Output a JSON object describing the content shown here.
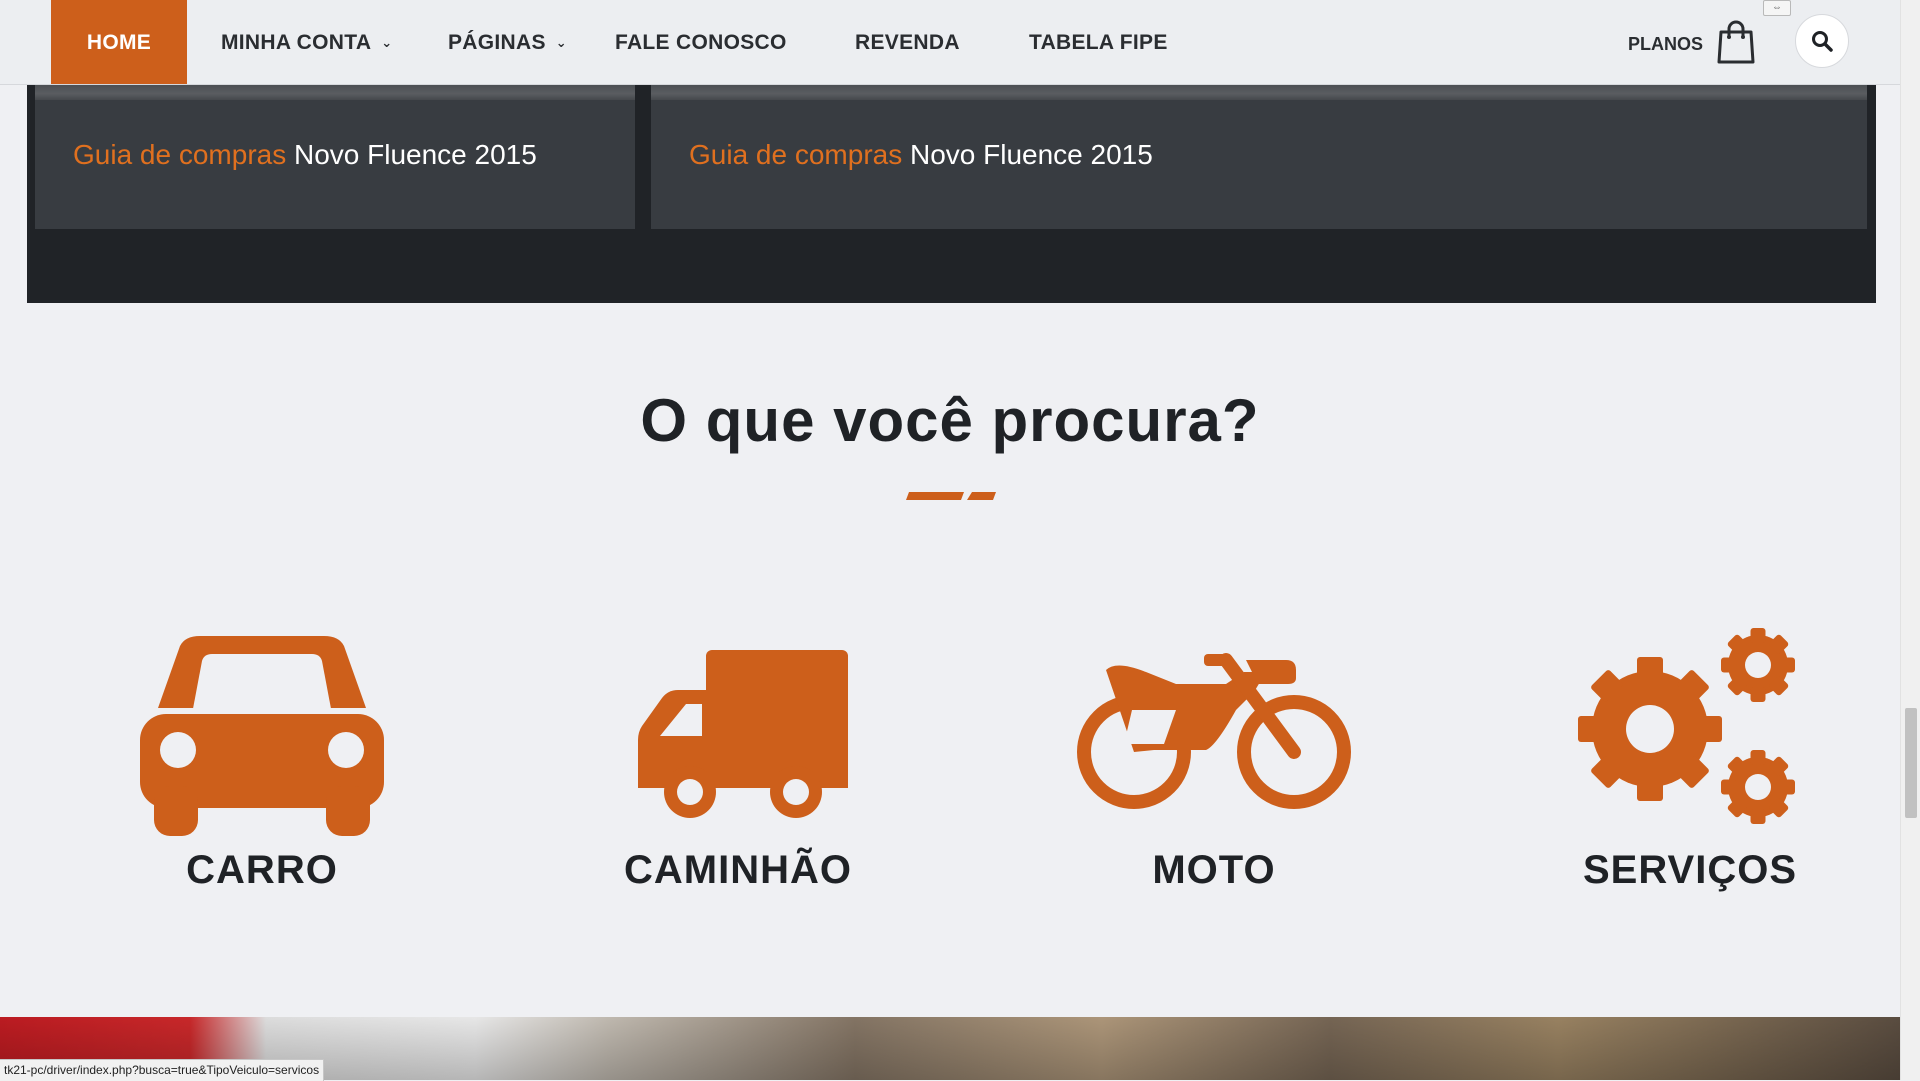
{
  "nav": {
    "items": [
      {
        "label": "HOME",
        "active": true,
        "has_dropdown": false
      },
      {
        "label": "MINHA CONTA",
        "active": false,
        "has_dropdown": true
      },
      {
        "label": "PÁGINAS",
        "active": false,
        "has_dropdown": true
      },
      {
        "label": "FALE CONOSCO",
        "active": false,
        "has_dropdown": false
      },
      {
        "label": "REVENDA",
        "active": false,
        "has_dropdown": false
      },
      {
        "label": "TABELA FIPE",
        "active": false,
        "has_dropdown": false
      }
    ],
    "planos_label": "PLANOS",
    "cart_icon": "shopping-bag-icon",
    "search_icon": "search-icon"
  },
  "news": {
    "cards": [
      {
        "tag": "Guia de compras",
        "title": "Novo Fluence 2015"
      },
      {
        "tag": "Guia de compras",
        "title": "Novo Fluence 2015"
      }
    ]
  },
  "section": {
    "title": "O que você procura?",
    "categories": [
      {
        "label": "CARRO",
        "icon": "car-icon"
      },
      {
        "label": "CAMINHÃO",
        "icon": "truck-icon"
      },
      {
        "label": "MOTO",
        "icon": "motorcycle-icon"
      },
      {
        "label": "SERVIÇOS",
        "icon": "gears-icon"
      }
    ]
  },
  "status_bar": {
    "url": "tk21-pc/driver/index.php?busca=true&TipoVeiculo=servicos"
  },
  "colors": {
    "accent": "#cd5f1b",
    "dark_band": "#202327",
    "card": "#383c41",
    "text_dark": "#1f2226",
    "background": "#eff0f3"
  }
}
